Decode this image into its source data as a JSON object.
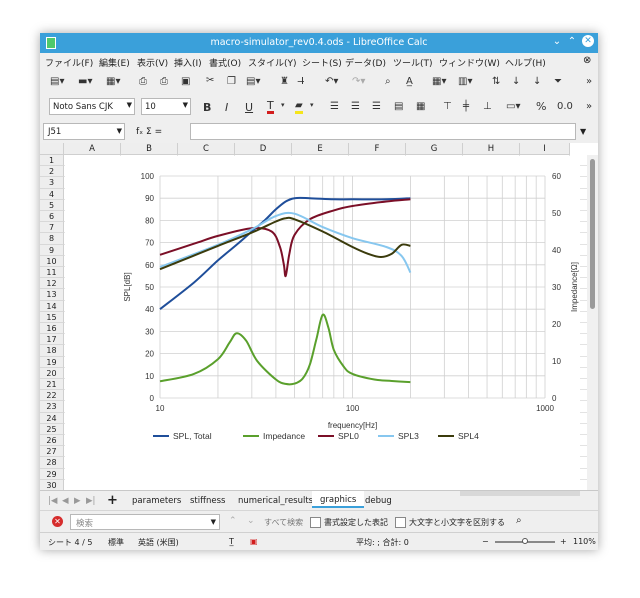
{
  "window": {
    "title": "macro-simulator_rev0.4.ods - LibreOffice Calc"
  },
  "menu": [
    "ファイル(F)",
    "編集(E)",
    "表示(V)",
    "挿入(I)",
    "書式(O)",
    "スタイル(Y)",
    "シート(S)",
    "データ(D)",
    "ツール(T)",
    "ウィンドウ(W)",
    "ヘルプ(H)"
  ],
  "format_bar": {
    "font_name": "Noto Sans CJK",
    "font_size": "10"
  },
  "formula_bar": {
    "name_box": "J51",
    "function_symbols": "fₓ Σ =",
    "content": ""
  },
  "columns": [
    "A",
    "B",
    "C",
    "D",
    "E",
    "F",
    "G",
    "H",
    "I"
  ],
  "rows": [
    "1",
    "2",
    "3",
    "4",
    "5",
    "6",
    "7",
    "8",
    "9",
    "10",
    "11",
    "12",
    "13",
    "14",
    "15",
    "16",
    "17",
    "18",
    "19",
    "20",
    "21",
    "22",
    "23",
    "24",
    "25",
    "26",
    "27",
    "28",
    "29",
    "30"
  ],
  "sheet_tabs": [
    "parameters",
    "stiffness",
    "numerical_results",
    "graphics",
    "debug"
  ],
  "active_tab": "graphics",
  "find_bar": {
    "placeholder": "検索",
    "find_all": "すべて検索",
    "formatted_display": "書式設定した表記",
    "match_case": "大文字と小文字を区別する"
  },
  "status_bar": {
    "sheet": "シート 4 / 5",
    "page_style": "標準",
    "language": "英語 (米国)",
    "summary": "平均: ; 合計: 0",
    "zoom": "110%"
  },
  "chart_data": {
    "type": "line",
    "xlabel": "frequency[Hz]",
    "ylabel": "SPL[dB]",
    "y2label": "Impedance[Ω]",
    "xscale": "log",
    "xlim": [
      10,
      1000
    ],
    "xticks": [
      "10",
      "100",
      "1000"
    ],
    "ylim": [
      0,
      100
    ],
    "yticks": [
      "0",
      "10",
      "20",
      "30",
      "40",
      "50",
      "60",
      "70",
      "80",
      "90",
      "100"
    ],
    "y2lim": [
      0,
      60
    ],
    "y2ticks": [
      "0",
      "10",
      "20",
      "30",
      "40",
      "50",
      "60"
    ],
    "grid": true,
    "legend_position": "bottom",
    "series": [
      {
        "name": "SPL, Total",
        "axis": "left",
        "color": "#1f4e9a",
        "x": [
          10,
          15,
          20,
          25,
          30,
          35,
          40,
          45,
          50,
          60,
          80,
          100,
          150,
          200
        ],
        "y": [
          40,
          52,
          62,
          69,
          75,
          80,
          85,
          88.5,
          90,
          90,
          89.5,
          89.5,
          89.5,
          90
        ]
      },
      {
        "name": "Impedance",
        "axis": "right",
        "color": "#5aa02c",
        "x": [
          10,
          15,
          20,
          23,
          25,
          28,
          32,
          40,
          45,
          50,
          55,
          60,
          65,
          70,
          75,
          80,
          90,
          100,
          130,
          160,
          200
        ],
        "y": [
          4.5,
          6.5,
          10.5,
          15,
          17.5,
          15.5,
          10,
          5,
          3.8,
          3.9,
          5.2,
          9,
          16,
          22.5,
          19,
          13,
          8.5,
          6.5,
          5,
          4.6,
          4.3
        ]
      },
      {
        "name": "SPL0",
        "axis": "left",
        "color": "#7b0f27",
        "x": [
          10,
          15,
          20,
          30,
          38,
          42,
          44,
          45,
          47,
          50,
          60,
          80,
          100,
          150,
          200
        ],
        "y": [
          64.5,
          69.5,
          73,
          76.5,
          75,
          68,
          60,
          55,
          65,
          73.5,
          80.5,
          84.5,
          86.5,
          88.5,
          89.5
        ]
      },
      {
        "name": "SPL3",
        "axis": "left",
        "color": "#87c7ef",
        "x": [
          10,
          20,
          30,
          40,
          50,
          70,
          100,
          150,
          180,
          200
        ],
        "y": [
          59,
          69,
          76,
          82,
          83,
          77,
          72,
          68,
          64,
          56.5
        ]
      },
      {
        "name": "SPL4",
        "axis": "left",
        "color": "#3b3b0c",
        "x": [
          10,
          20,
          30,
          40,
          45,
          50,
          70,
          100,
          120,
          140,
          160,
          180,
          200
        ],
        "y": [
          58,
          68.5,
          74.5,
          79.5,
          81,
          80.5,
          75,
          68,
          65,
          63.5,
          65,
          69,
          68.5
        ]
      }
    ]
  }
}
